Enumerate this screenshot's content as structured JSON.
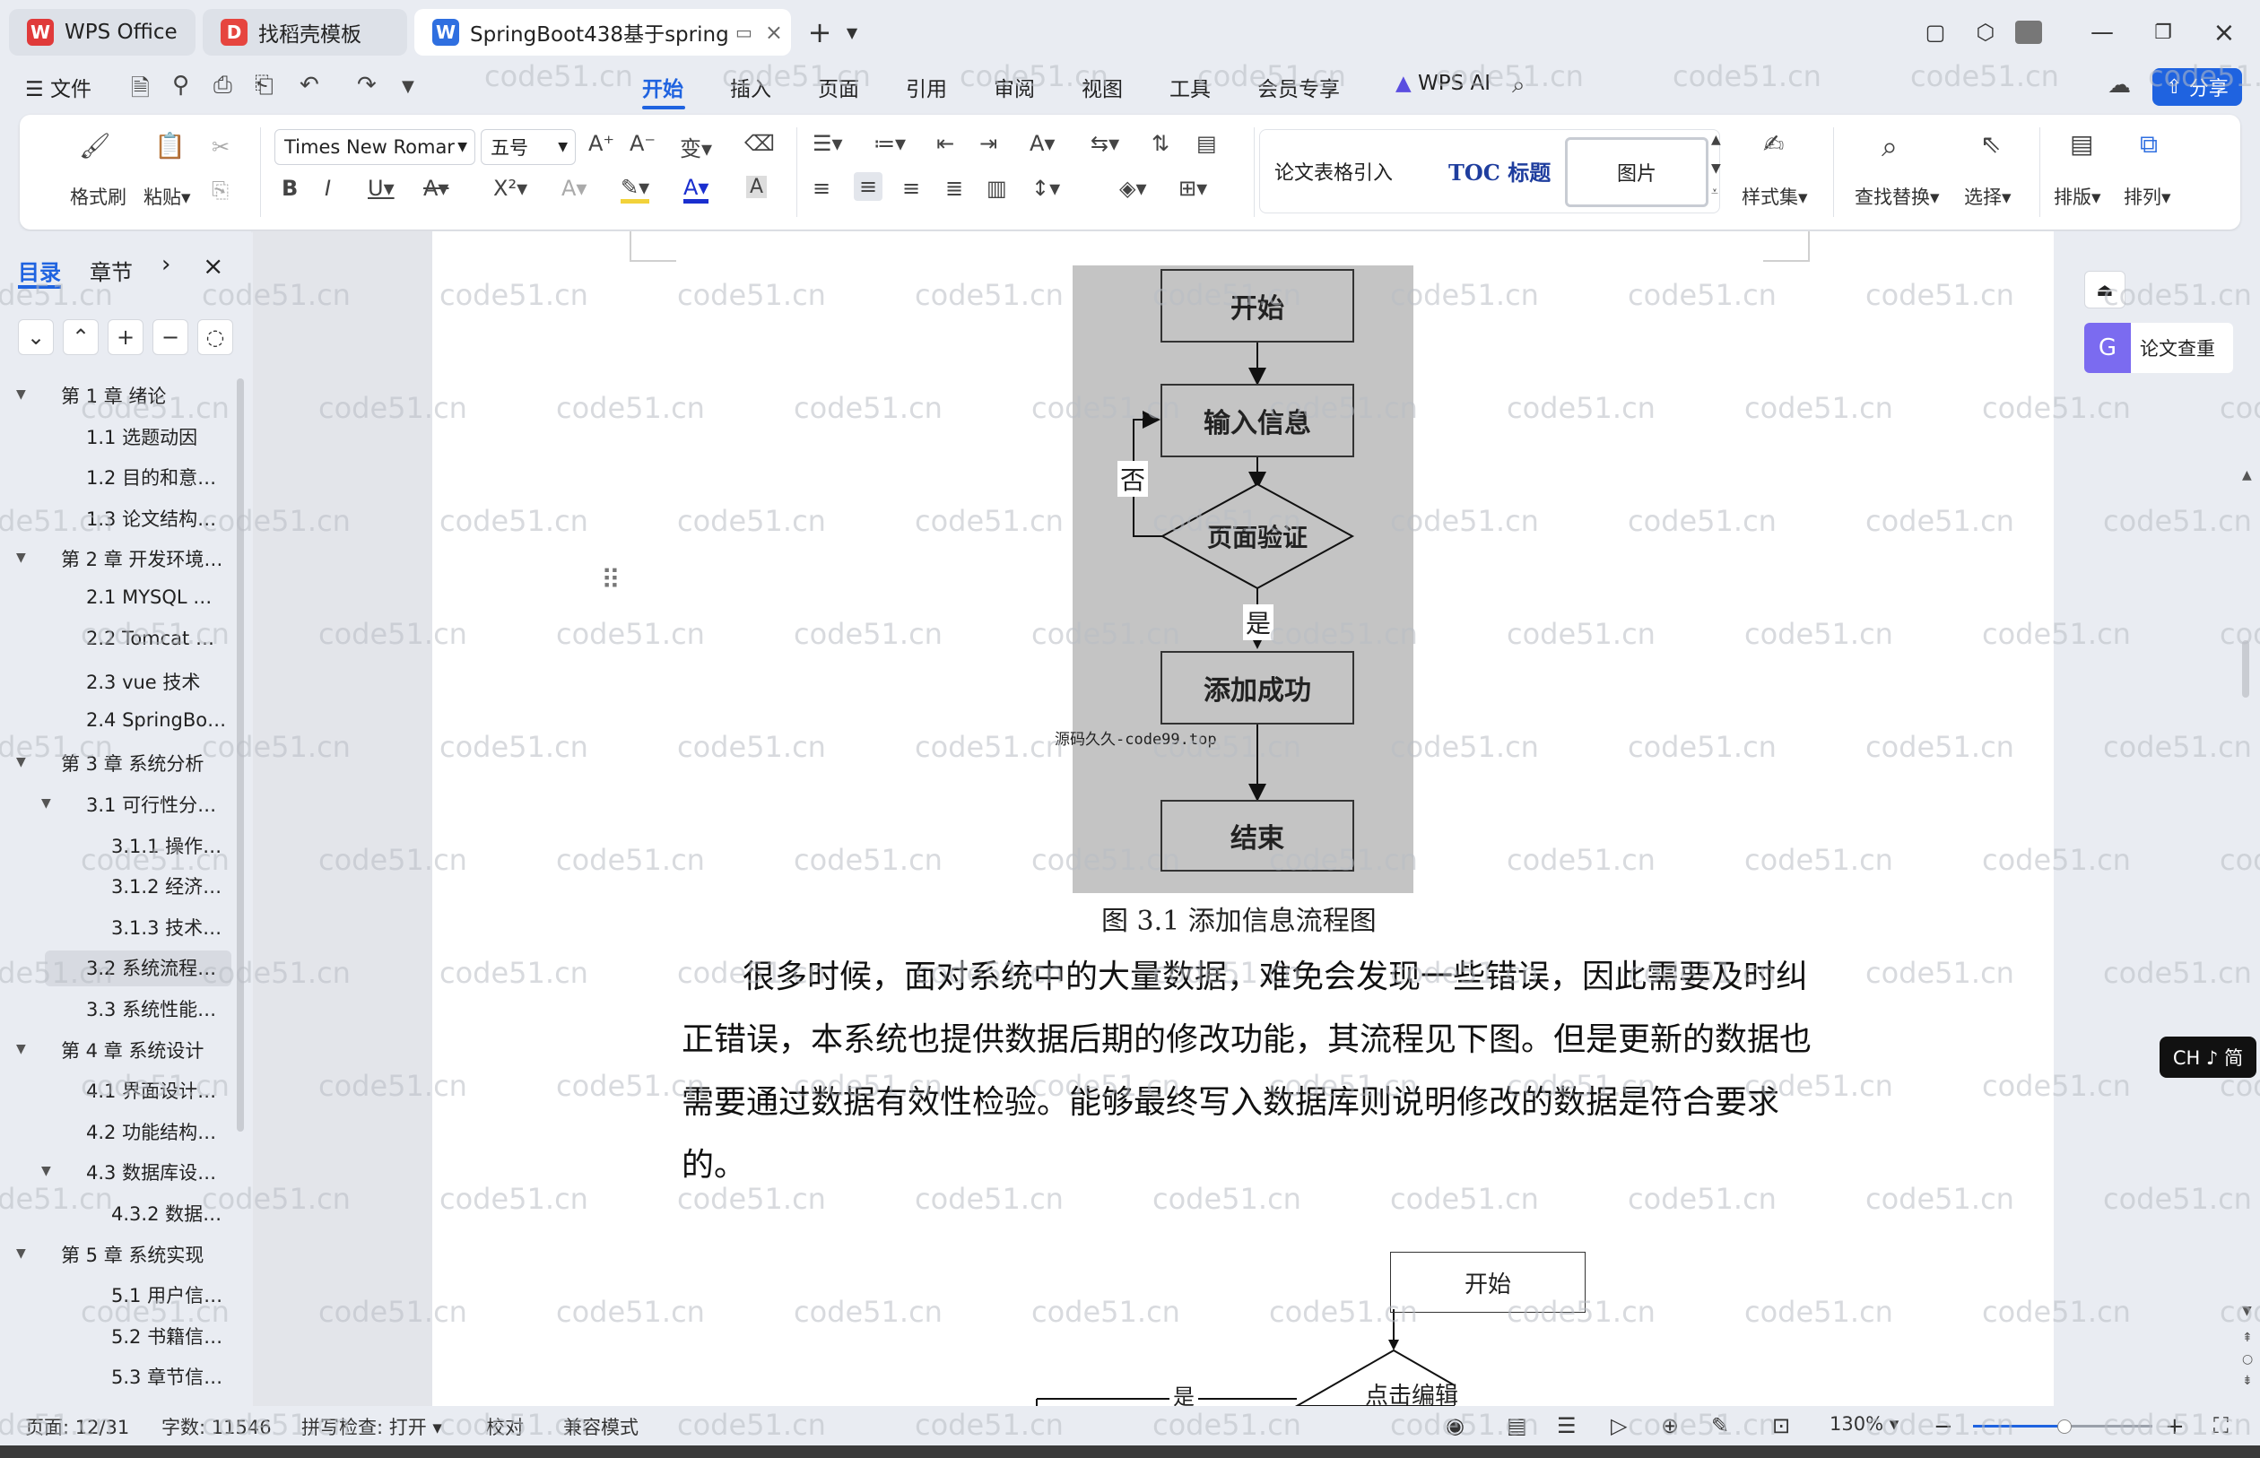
{
  "tabs": [
    {
      "label": "WPS Office"
    },
    {
      "label": "找稻壳模板"
    },
    {
      "label": "SpringBoot438基于springbo"
    }
  ],
  "menu": {
    "file": "文件",
    "items": [
      "开始",
      "插入",
      "页面",
      "引用",
      "审阅",
      "视图",
      "工具",
      "会员专享"
    ],
    "wps_ai": "WPS AI",
    "share": "分享"
  },
  "ribbon": {
    "format_painter": "格式刷",
    "paste": "粘贴",
    "font_name": "Times New Romar",
    "font_size": "五号",
    "styles": {
      "s1": "论文表格引入",
      "s2": "TOC 标题",
      "s3": "图片"
    },
    "style_set": "样式集",
    "find_replace": "查找替换",
    "select": "选择",
    "layout": "排版",
    "arrange": "排列"
  },
  "nav": {
    "tab_toc": "目录",
    "tab_section": "章节",
    "items": [
      {
        "label": "第 1 章  绪论",
        "level": 0
      },
      {
        "label": "1.1 选题动因",
        "level": 1
      },
      {
        "label": "1.2 目的和意…",
        "level": 1
      },
      {
        "label": "1.3 论文结构…",
        "level": 1
      },
      {
        "label": "第 2 章  开发环境…",
        "level": 0
      },
      {
        "label": "2.1 MYSQL …",
        "level": 1
      },
      {
        "label": "2.2 Tomcat …",
        "level": 1
      },
      {
        "label": "2.3 vue 技术",
        "level": 1
      },
      {
        "label": "2.4 SpringBo…",
        "level": 1
      },
      {
        "label": "第 3 章  系统分析",
        "level": 0
      },
      {
        "label": "3.1 可行性分…",
        "level": 1
      },
      {
        "label": "3.1.1 操作…",
        "level": 2
      },
      {
        "label": "3.1.2 经济…",
        "level": 2
      },
      {
        "label": "3.1.3 技术…",
        "level": 2
      },
      {
        "label": "3.2 系统流程…",
        "level": 1
      },
      {
        "label": "3.3 系统性能…",
        "level": 1
      },
      {
        "label": "第 4 章  系统设计",
        "level": 0
      },
      {
        "label": "4.1 界面设计…",
        "level": 1
      },
      {
        "label": "4.2 功能结构…",
        "level": 1
      },
      {
        "label": "4.3 数据库设…",
        "level": 1
      },
      {
        "label": "4.3.2  数据…",
        "level": 2
      },
      {
        "label": "第 5 章  系统实现",
        "level": 0
      },
      {
        "label": "5.1 用户信…",
        "level": 2
      },
      {
        "label": "5.2  书籍信…",
        "level": 2
      },
      {
        "label": "5.3 章节信…",
        "level": 2
      }
    ]
  },
  "flowchart1": {
    "start": "开始",
    "input": "输入信息",
    "verify": "页面验证",
    "no": "否",
    "yes": "是",
    "success": "添加成功",
    "end": "结束",
    "watermark_text": "源码久久-code99.top"
  },
  "figure_caption": "图 3.1  添加信息流程图",
  "body_lines": [
    "很多时候，面对系统中的大量数据，难免会发现一些错误，因此需要及时纠",
    "正错误，本系统也提供数据后期的修改功能，其流程见下图。但是更新的数据也",
    "需要通过数据有效性检验。能够最终写入数据库则说明修改的数据是符合要求",
    "的。"
  ],
  "flowchart2": {
    "start": "开始",
    "click_edit": "点击编辑",
    "yes": "是"
  },
  "right_panel": {
    "plagiarism": "论文查重",
    "ime": "CH ♪ 简"
  },
  "status": {
    "page": "页面: 12/31",
    "words": "字数: 11546",
    "spell": "拼写检查: 打开",
    "proof": "校对",
    "compat": "兼容模式",
    "zoom": "130%"
  },
  "watermark": "code51.cn"
}
